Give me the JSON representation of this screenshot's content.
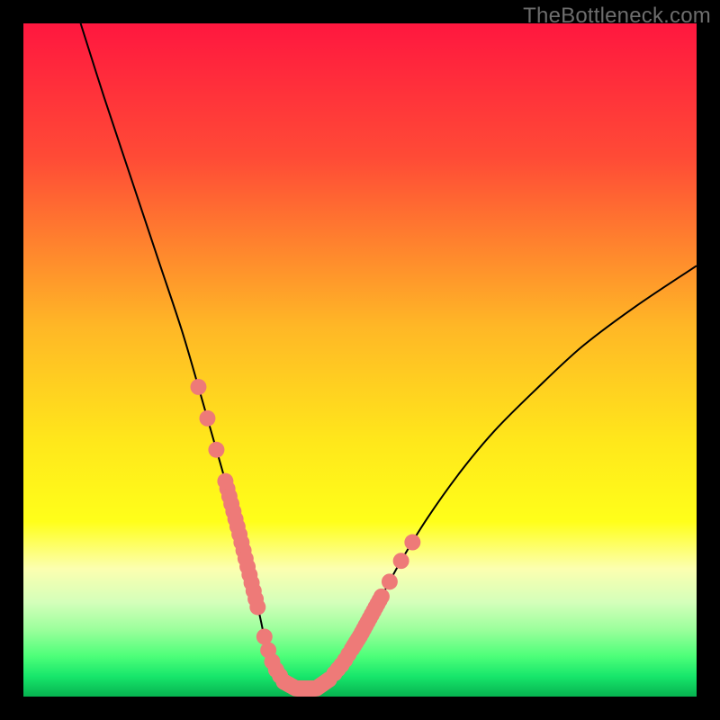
{
  "watermark": "TheBottleneck.com",
  "chart_data": {
    "type": "line",
    "title": "",
    "xlabel": "",
    "ylabel": "",
    "xlim": [
      0,
      100
    ],
    "ylim": [
      0,
      100
    ],
    "gradient_stops": [
      {
        "offset": 0.0,
        "color": "#ff173f"
      },
      {
        "offset": 0.2,
        "color": "#ff4b36"
      },
      {
        "offset": 0.45,
        "color": "#ffb726"
      },
      {
        "offset": 0.62,
        "color": "#ffe71b"
      },
      {
        "offset": 0.74,
        "color": "#ffff1a"
      },
      {
        "offset": 0.81,
        "color": "#fcffb0"
      },
      {
        "offset": 0.86,
        "color": "#d4ffba"
      },
      {
        "offset": 0.9,
        "color": "#9cff9c"
      },
      {
        "offset": 0.94,
        "color": "#4dff79"
      },
      {
        "offset": 0.97,
        "color": "#17e66b"
      },
      {
        "offset": 1.0,
        "color": "#06b24f"
      }
    ],
    "series": [
      {
        "name": "bottleneck-curve",
        "color": "#000000",
        "x": [
          8.5,
          12,
          16,
          20,
          23.5,
          26,
          28,
          30,
          32,
          33.5,
          35,
          36,
          37.2,
          38.7,
          40.5,
          43.5,
          45.5,
          47.5,
          50,
          53,
          56,
          60,
          65,
          70,
          76,
          83,
          91,
          100
        ],
        "y": [
          100,
          89,
          77,
          65,
          54.5,
          46,
          39,
          32,
          24.5,
          18.5,
          12.5,
          8,
          4.5,
          2.2,
          1.2,
          1.2,
          2.6,
          5,
          9,
          14.5,
          20,
          26.5,
          33.5,
          39.5,
          45.5,
          52,
          58,
          64
        ]
      }
    ],
    "markers": {
      "name": "curve-dots",
      "color": "#ee7a78",
      "radius": 1.2,
      "segments": [
        {
          "x_range": [
            26.0,
            30.0
          ],
          "count": 4
        },
        {
          "x_range": [
            30.3,
            34.8
          ],
          "count": 16
        },
        {
          "x_range": [
            35.8,
            38.7
          ],
          "count": 6
        },
        {
          "x_range": [
            38.9,
            45.4
          ],
          "count": 22
        },
        {
          "x_range": [
            46.2,
            48.3
          ],
          "count": 5
        },
        {
          "x_range": [
            48.8,
            53.2
          ],
          "count": 16
        },
        {
          "x_range": [
            54.4,
            57.8
          ],
          "count": 3
        }
      ]
    }
  }
}
